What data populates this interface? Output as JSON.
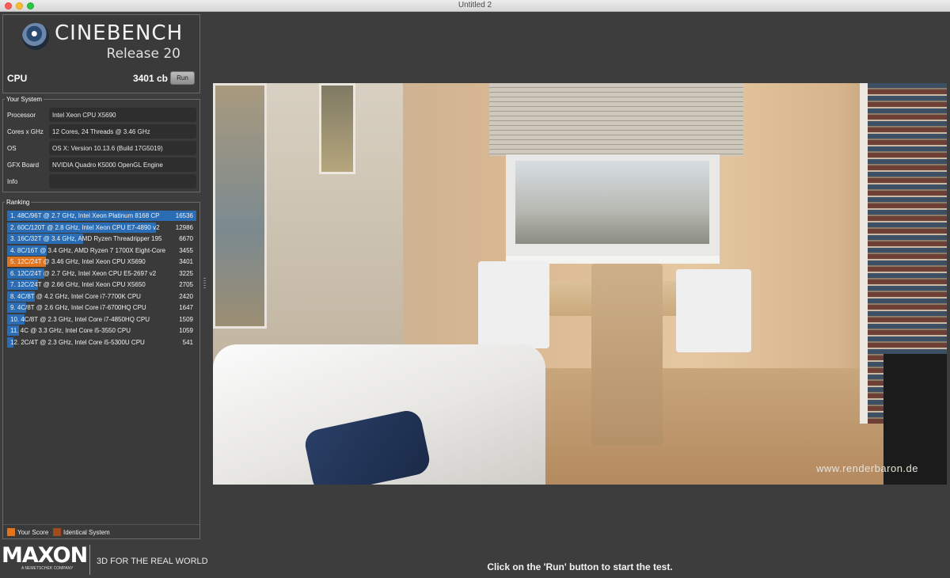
{
  "window": {
    "title": "Untitled 2"
  },
  "logo": {
    "name": "CINEBENCH",
    "release": "Release 20"
  },
  "cpu": {
    "label": "CPU",
    "score": "3401 cb",
    "run_label": "Run"
  },
  "system": {
    "title": "Your System",
    "rows": [
      {
        "key": "Processor",
        "value": "Intel Xeon CPU X5690"
      },
      {
        "key": "Cores x GHz",
        "value": "12 Cores, 24 Threads @ 3.46 GHz"
      },
      {
        "key": "OS",
        "value": "OS X: Version 10.13.6 (Build 17G5019)"
      },
      {
        "key": "GFX Board",
        "value": "NVIDIA Quadro K5000 OpenGL Engine"
      },
      {
        "key": "Info",
        "value": ""
      }
    ]
  },
  "ranking": {
    "title": "Ranking",
    "max_score": 16536,
    "items": [
      {
        "text": "1. 48C/96T @ 2.7 GHz, Intel Xeon Platinum 8168 CP",
        "score": "16536",
        "value": 16536,
        "mine": false
      },
      {
        "text": "2. 60C/120T @ 2.8 GHz, Intel Xeon CPU E7-4890 v2",
        "score": "12986",
        "value": 12986,
        "mine": false
      },
      {
        "text": "3. 16C/32T @ 3.4 GHz, AMD Ryzen Threadripper 195",
        "score": "6670",
        "value": 6670,
        "mine": false
      },
      {
        "text": "4. 8C/16T @ 3.4 GHz, AMD Ryzen 7 1700X Eight-Core",
        "score": "3455",
        "value": 3455,
        "mine": false
      },
      {
        "text": "5. 12C/24T @ 3.46 GHz, Intel Xeon CPU X5690",
        "score": "3401",
        "value": 3401,
        "mine": true
      },
      {
        "text": "6. 12C/24T @ 2.7 GHz, Intel Xeon CPU E5-2697 v2",
        "score": "3225",
        "value": 3225,
        "mine": false
      },
      {
        "text": "7. 12C/24T @ 2.66 GHz, Intel Xeon CPU X5650",
        "score": "2705",
        "value": 2705,
        "mine": false
      },
      {
        "text": "8. 4C/8T @ 4.2 GHz, Intel Core i7-7700K CPU",
        "score": "2420",
        "value": 2420,
        "mine": false
      },
      {
        "text": "9. 4C/8T @ 2.6 GHz, Intel Core i7-6700HQ CPU",
        "score": "1647",
        "value": 1647,
        "mine": false
      },
      {
        "text": "10. 4C/8T @ 2.3 GHz, Intel Core i7-4850HQ CPU",
        "score": "1509",
        "value": 1509,
        "mine": false
      },
      {
        "text": "11. 4C @ 3.3 GHz, Intel Core i5-3550 CPU",
        "score": "1059",
        "value": 1059,
        "mine": false
      },
      {
        "text": "12. 2C/4T @ 2.3 GHz, Intel Core i5-5300U CPU",
        "score": "541",
        "value": 541,
        "mine": false
      }
    ],
    "legend": [
      {
        "label": "Your Score",
        "color": "#e0741f"
      },
      {
        "label": "Identical System",
        "color": "#a04a1e"
      }
    ]
  },
  "footer": {
    "brand": "MAXON",
    "subtitle": "A NEMETSCHEK COMPANY",
    "tagline": "3D FOR THE REAL WORLD"
  },
  "render": {
    "watermark": "www.renderbaron.de"
  },
  "status": "Click on the 'Run' button to start the test."
}
